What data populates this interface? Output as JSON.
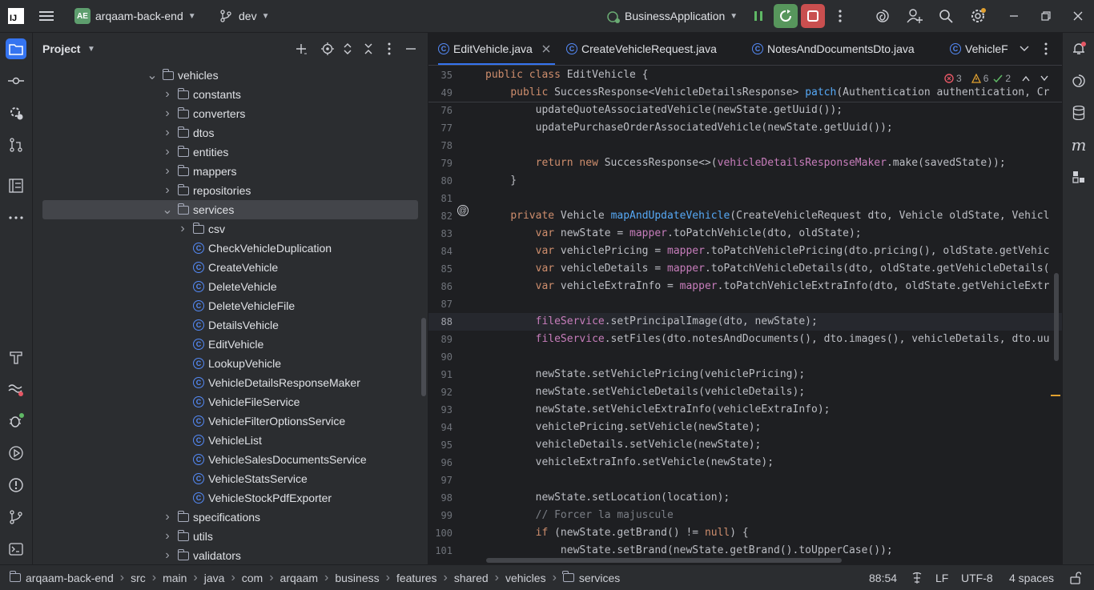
{
  "titlebar": {
    "logo": "IJ",
    "project_badge": "AE",
    "project_name": "arqaam-back-end",
    "branch": "dev",
    "run_config": "BusinessApplication"
  },
  "project_panel": {
    "title": "Project",
    "tree": [
      {
        "label": "vehicles",
        "type": "folder",
        "expanded": true,
        "indent": 0
      },
      {
        "label": "constants",
        "type": "folder",
        "expanded": false,
        "indent": 1
      },
      {
        "label": "converters",
        "type": "folder",
        "expanded": false,
        "indent": 1
      },
      {
        "label": "dtos",
        "type": "folder",
        "expanded": false,
        "indent": 1
      },
      {
        "label": "entities",
        "type": "folder",
        "expanded": false,
        "indent": 1
      },
      {
        "label": "mappers",
        "type": "folder",
        "expanded": false,
        "indent": 1
      },
      {
        "label": "repositories",
        "type": "folder",
        "expanded": false,
        "indent": 1
      },
      {
        "label": "services",
        "type": "folder",
        "expanded": true,
        "indent": 1,
        "selected": true
      },
      {
        "label": "csv",
        "type": "folder",
        "expanded": false,
        "indent": 2
      },
      {
        "label": "CheckVehicleDuplication",
        "type": "class",
        "indent": 2
      },
      {
        "label": "CreateVehicle",
        "type": "class",
        "indent": 2
      },
      {
        "label": "DeleteVehicle",
        "type": "class",
        "indent": 2
      },
      {
        "label": "DeleteVehicleFile",
        "type": "class",
        "indent": 2
      },
      {
        "label": "DetailsVehicle",
        "type": "class",
        "indent": 2
      },
      {
        "label": "EditVehicle",
        "type": "class",
        "indent": 2
      },
      {
        "label": "LookupVehicle",
        "type": "class",
        "indent": 2
      },
      {
        "label": "VehicleDetailsResponseMaker",
        "type": "class",
        "indent": 2
      },
      {
        "label": "VehicleFileService",
        "type": "class",
        "indent": 2
      },
      {
        "label": "VehicleFilterOptionsService",
        "type": "class",
        "indent": 2
      },
      {
        "label": "VehicleList",
        "type": "class",
        "indent": 2
      },
      {
        "label": "VehicleSalesDocumentsService",
        "type": "class",
        "indent": 2
      },
      {
        "label": "VehicleStatsService",
        "type": "class",
        "indent": 2
      },
      {
        "label": "VehicleStockPdfExporter",
        "type": "class",
        "indent": 2
      },
      {
        "label": "specifications",
        "type": "folder",
        "expanded": false,
        "indent": 1
      },
      {
        "label": "utils",
        "type": "folder",
        "expanded": false,
        "indent": 1
      },
      {
        "label": "validators",
        "type": "folder",
        "expanded": false,
        "indent": 1
      }
    ]
  },
  "editor": {
    "tabs": [
      {
        "label": "EditVehicle.java",
        "active": true,
        "closable": true
      },
      {
        "label": "CreateVehicleRequest.java",
        "active": false
      },
      {
        "label": "NotesAndDocumentsDto.java",
        "active": false
      },
      {
        "label": "VehicleF",
        "active": false
      }
    ],
    "inspections": {
      "errors": "3",
      "warnings": "6",
      "weak_warnings": "2"
    },
    "lines": [
      {
        "n": "35",
        "text": "public class EditVehicle {"
      },
      {
        "n": "49",
        "text": "    public SuccessResponse<VehicleDetailsResponse> patch(Authentication authentication, Cr"
      },
      {
        "n": "76",
        "text": "        updateQuoteAssociatedVehicle(newState.getUuid());"
      },
      {
        "n": "77",
        "text": "        updatePurchaseOrderAssociatedVehicle(newState.getUuid());"
      },
      {
        "n": "78",
        "text": ""
      },
      {
        "n": "79",
        "text": "        return new SuccessResponse<>(vehicleDetailsResponseMaker.make(savedState));"
      },
      {
        "n": "80",
        "text": "    }"
      },
      {
        "n": "81",
        "text": ""
      },
      {
        "n": "82",
        "text": "    private Vehicle mapAndUpdateVehicle(CreateVehicleRequest dto, Vehicle oldState, Vehicl"
      },
      {
        "n": "83",
        "text": "        var newState = mapper.toPatchVehicle(dto, oldState);"
      },
      {
        "n": "84",
        "text": "        var vehiclePricing = mapper.toPatchVehiclePricing(dto.pricing(), oldState.getVehic"
      },
      {
        "n": "85",
        "text": "        var vehicleDetails = mapper.toPatchVehicleDetails(dto, oldState.getVehicleDetails("
      },
      {
        "n": "86",
        "text": "        var vehicleExtraInfo = mapper.toPatchVehicleExtraInfo(dto, oldState.getVehicleExtr"
      },
      {
        "n": "87",
        "text": ""
      },
      {
        "n": "88",
        "text": "        fileService.setPrincipalImage(dto, newState);"
      },
      {
        "n": "89",
        "text": "        fileService.setFiles(dto.notesAndDocuments(), dto.images(), vehicleDetails, dto.uu"
      },
      {
        "n": "90",
        "text": ""
      },
      {
        "n": "91",
        "text": "        newState.setVehiclePricing(vehiclePricing);"
      },
      {
        "n": "92",
        "text": "        newState.setVehicleDetails(vehicleDetails);"
      },
      {
        "n": "93",
        "text": "        newState.setVehicleExtraInfo(vehicleExtraInfo);"
      },
      {
        "n": "94",
        "text": "        vehiclePricing.setVehicle(newState);"
      },
      {
        "n": "95",
        "text": "        vehicleDetails.setVehicle(newState);"
      },
      {
        "n": "96",
        "text": "        vehicleExtraInfo.setVehicle(newState);"
      },
      {
        "n": "97",
        "text": ""
      },
      {
        "n": "98",
        "text": "        newState.setLocation(location);"
      },
      {
        "n": "99",
        "text": "        // Forcer la majuscule"
      },
      {
        "n": "100",
        "text": "        if (newState.getBrand() != null) {"
      },
      {
        "n": "101",
        "text": "            newState.setBrand(newState.getBrand().toUpperCase());"
      }
    ]
  },
  "statusbar": {
    "breadcrumbs": [
      "arqaam-back-end",
      "src",
      "main",
      "java",
      "com",
      "arqaam",
      "business",
      "features",
      "shared",
      "vehicles",
      "services"
    ],
    "position": "88:54",
    "line_sep": "LF",
    "encoding": "UTF-8",
    "indent": "4 spaces"
  },
  "colors": {
    "accent": "#3574f0",
    "run_green": "#57965c",
    "stop_red": "#c94f4f"
  }
}
